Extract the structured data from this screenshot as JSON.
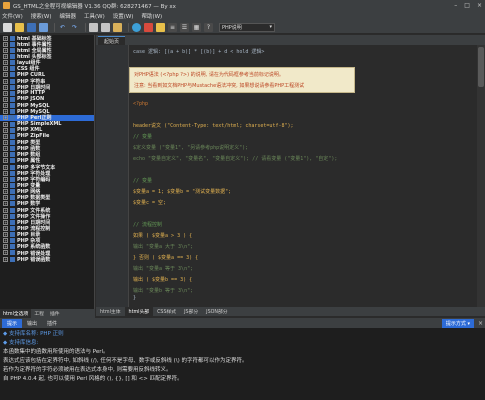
{
  "window": {
    "title": "GS_HTML之全程可视编辑器 V1.36 QQ群: 628271467 — By xx"
  },
  "menu": [
    "文件(W)",
    "搜索(W)",
    "编辑器",
    "工具(W)",
    "设置(W)",
    "帮助(W)"
  ],
  "toolbar": {
    "combo_value": "PHP说明"
  },
  "sidebar": {
    "items": [
      "html 基础标签",
      "html 事件属性",
      "html 全局属性",
      "html 头部标签",
      "layui组件",
      "CSS 组件",
      "PHP CURL",
      "PHP 字符串",
      "PHP 日期时间",
      "PHP HTTP",
      "PHP JSON",
      "PHP MySQL",
      "PHP MySQL",
      "PHP Perl正则",
      "PHP SimpleXML",
      "PHP XML",
      "PHP ZipFile",
      "PHP 类型",
      "PHP 函数",
      "PHP 数组",
      "PHP 属性",
      "PHP 多字节文本",
      "PHP 字符处理",
      "PHP 字符编码",
      "PHP 变量",
      "PHP 网络",
      "PHP 数据类型",
      "PHP 数学",
      "PHP 文件系统",
      "PHP 文件操作",
      "PHP 日期时间",
      "PHP 流程控制",
      "PHP 目录",
      "PHP 杂项",
      "PHP 系统函数",
      "PHP 错误处理",
      "PHP 错误函数"
    ],
    "selected_index": 13,
    "tabs": [
      "html全选项",
      "工程",
      "插件"
    ]
  },
  "editor": {
    "tab_label": "起始页",
    "header_line": "case 逻辑: [(a + b)] * [(b)] + d < hold 逻辑>",
    "tip_line1": "对PHP语法 (<?php ?>) 的说明, 请在为代码框参考当前标记说明。",
    "tip_line2": "注意: 当看到如文档PHP与Mustache语法冲突, 如果想说请参看PHP工程测试",
    "code_lines": [
      "<?php",
      "",
      "header说文 (\"Content-Type: text/html; charset=utf-8\");",
      "// 变量",
      "$定义变量 (\"变量1\", \"另请参考php说明定义\");",
      "echo \"变量自定义\", \"变量名\", \"变量自定义\"); // 请看变量 (\"变量1\"), \"自定\");",
      "",
      "// 变量",
      "$变量a = 1; $变量b = \"测试变量数据\";",
      "$变量c = 空;",
      "",
      "// 流程控制",
      "如果 ( $变量a > 3 ) {",
      "    输出 \"变量a 大于 3\\n\";",
      "} 否则 ( $变量a == 3) {",
      "    输出 \"变量a 等于 3\\n\";",
      "    输出 ( $变量b == 3) {",
      "        输出 \"变量b 等于 3\\n\";",
      "    }",
      "}"
    ],
    "bottom_tabs": [
      "html主体",
      "html头部",
      "CSS样式",
      "JS部分",
      "JSON部分"
    ]
  },
  "output": {
    "tabs": [
      "提示",
      "输出",
      "插件"
    ],
    "right_label": "提示方式 ▾",
    "lines": [
      "◆ 支持库名称: PHP 正则",
      "◆ 支持库信息:",
      "本函数集中的函数用所使用的语法与 Perl。",
      "表达式应该包括在定界符中, 如斜线 (/), 任何不是字母、数字或反斜线 (\\) 的字符都可以作为定界符。",
      "若作为定界符的字符必须被用在表达式本身中, 则需要用反斜线转义。",
      "自 PHP 4.0.4 起, 也可以使用 Perl 风格的 (), {}, [] 和 <> 匹配定界符。"
    ]
  },
  "colors": {
    "selection": "#2d6bd6",
    "accent": "#4a88c7"
  }
}
